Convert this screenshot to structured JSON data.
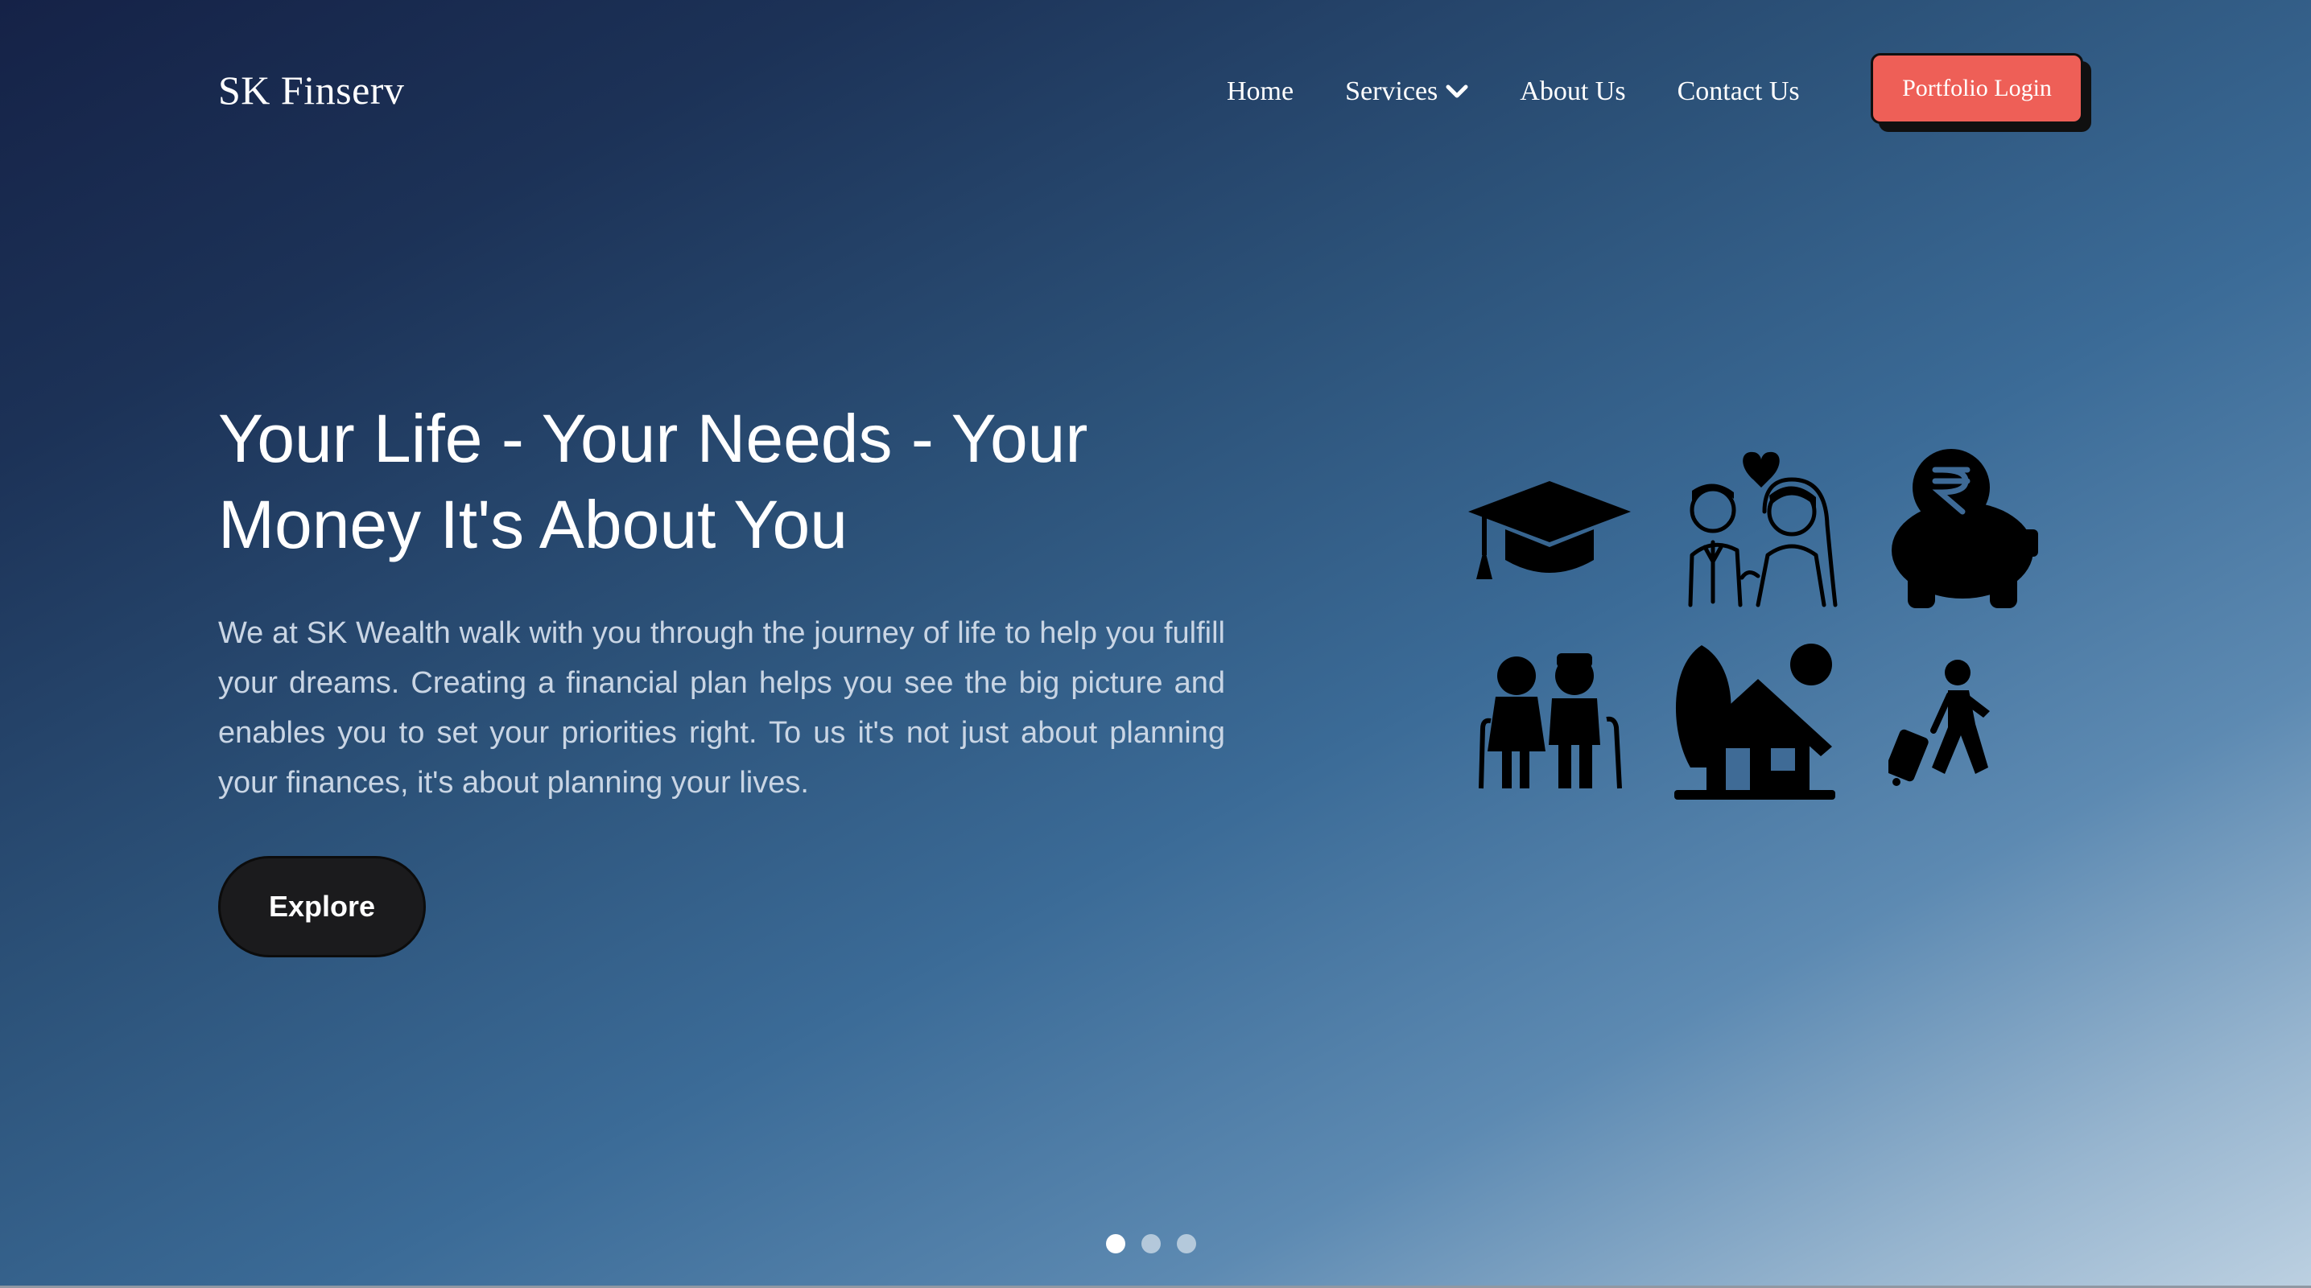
{
  "brand": {
    "name": "SK Finserv"
  },
  "nav": {
    "items": [
      "Home",
      "Services",
      "About Us",
      "Contact Us"
    ],
    "cta_label": "Portfolio Login"
  },
  "hero": {
    "title_line1": "Your Life - Your Needs - Your",
    "title_line2": "Money It's About You",
    "description": "We at SK Wealth walk with you through the journey of life to help you fulfill your dreams. Creating a financial plan helps you see the big picture and enables you to set your priorities right. To us it's not just about planning your finances, it's about planning your lives.",
    "cta_label": "Explore"
  },
  "icons": [
    "graduation-cap-icon",
    "wedding-couple-icon",
    "piggy-bank-rupee-icon",
    "elderly-couple-icon",
    "house-icon",
    "traveler-icon"
  ],
  "carousel": {
    "slide_count": 3,
    "active_index": 0
  },
  "colors": {
    "accent": "#ee5f57",
    "explore_button": "#1b1b1d",
    "background_top": "#152247",
    "background_bottom": "#bcd0e1"
  }
}
